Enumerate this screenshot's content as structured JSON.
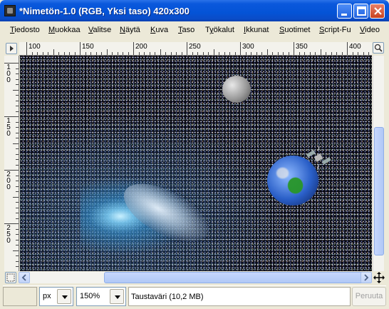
{
  "window": {
    "title": "*Nimetön-1.0 (RGB, Yksi taso) 420x300"
  },
  "menu": [
    {
      "label": "Tiedosto",
      "u": "T",
      "rest": "iedosto"
    },
    {
      "label": "Muokkaa",
      "u": "M",
      "rest": "uokkaa"
    },
    {
      "label": "Valitse",
      "u": "V",
      "rest": "alitse"
    },
    {
      "label": "Näytä",
      "u": "N",
      "rest": "äytä"
    },
    {
      "label": "Kuva",
      "u": "K",
      "rest": "uva"
    },
    {
      "label": "Taso",
      "u": "T",
      "rest": "aso"
    },
    {
      "label": "Työkalut",
      "u": "y",
      "pre": "T",
      "rest": "ökalut"
    },
    {
      "label": "Ikkunat",
      "u": "I",
      "rest": "kkunat"
    },
    {
      "label": "Suotimet",
      "u": "S",
      "rest": "uotimet"
    },
    {
      "label": "Script-Fu",
      "u": "S",
      "rest": "cript-Fu"
    },
    {
      "label": "Video",
      "u": "V",
      "rest": "ideo"
    }
  ],
  "hruler": {
    "labels": [
      "100",
      "150",
      "200",
      "250",
      "300",
      "350",
      "400"
    ]
  },
  "vruler": {
    "labels": [
      "100",
      "150",
      "200",
      "250"
    ]
  },
  "statusbar": {
    "unit": "px",
    "zoom": "150%",
    "message": "Taustaväri (10,2 MB)",
    "cancel_label": "Peruuta"
  },
  "icons": [
    "app-icon",
    "minimize-icon",
    "maximize-icon",
    "close-icon",
    "ruler-corner-icon",
    "zoom-fit-icon",
    "navigate-icon",
    "quick-mask-icon"
  ],
  "colors": {
    "titlebar": "#0453d6",
    "canvas_bg": "#0a0a14"
  }
}
